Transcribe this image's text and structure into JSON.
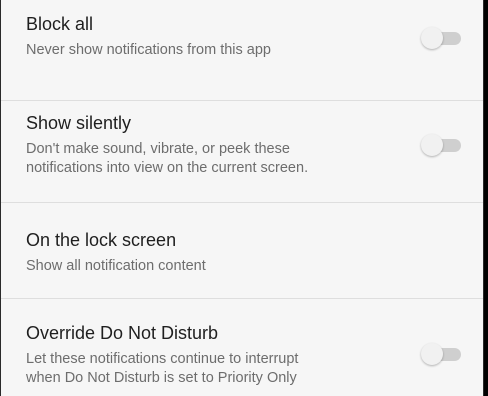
{
  "settings": [
    {
      "title": "Block all",
      "subtitle": "Never show notifications from this app",
      "has_toggle": true,
      "toggle_on": false
    },
    {
      "title": "Show silently",
      "subtitle": "Don't make sound, vibrate, or peek these\nnotifications into view on the current screen.",
      "has_toggle": true,
      "toggle_on": false
    },
    {
      "title": "On the lock screen",
      "subtitle": "Show all notification content",
      "has_toggle": false
    },
    {
      "title": "Override Do Not Disturb",
      "subtitle": "Let these notifications continue to interrupt\nwhen Do Not Disturb is set to Priority Only",
      "has_toggle": true,
      "toggle_on": false
    }
  ],
  "colors": {
    "background": "#f6f6f6",
    "title_text": "#1f1f1f",
    "subtitle_text": "#6d6d6d",
    "toggle_track_off": "#cfcfcf",
    "toggle_thumb_off": "#f1f1f1",
    "divider": "#dedede"
  }
}
